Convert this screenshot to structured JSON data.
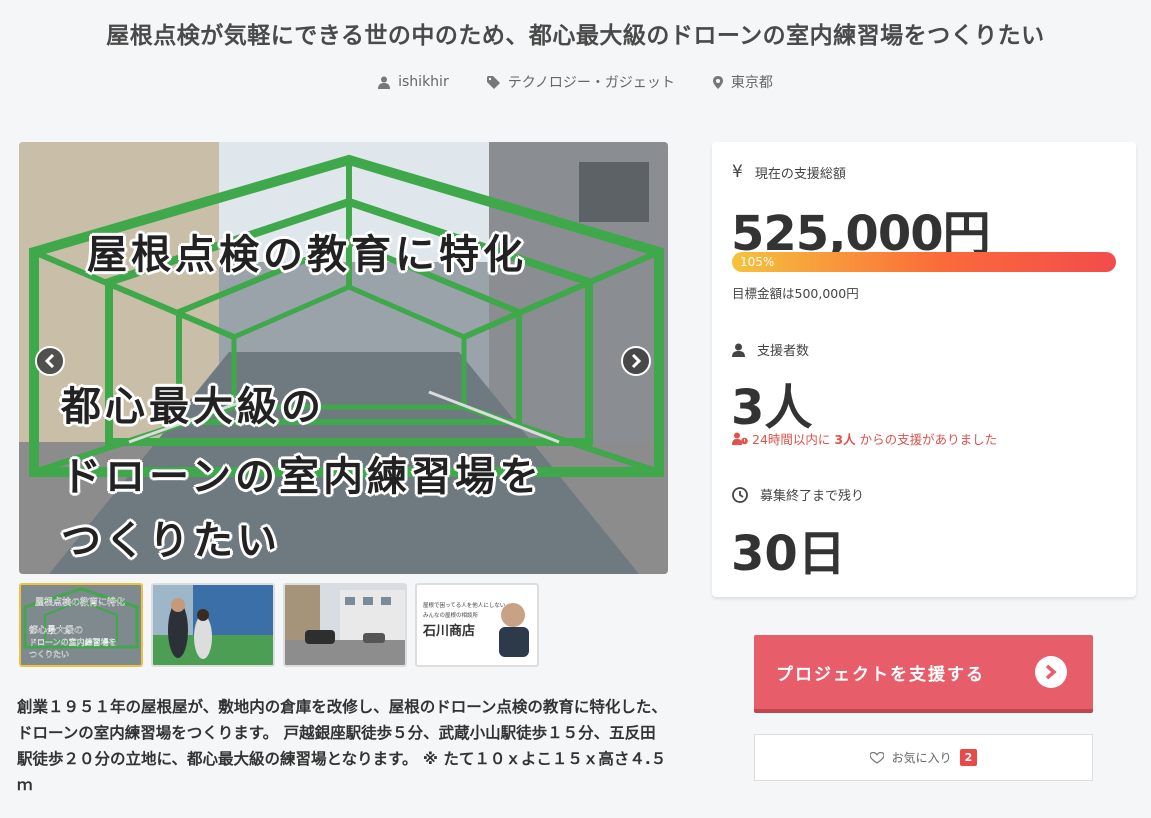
{
  "project": {
    "title": "屋根点検が気軽にできる世の中のため、都心最大級のドローンの室内練習場をつくりたい",
    "owner": "ishikhir",
    "category": "テクノロジー・ガジェット",
    "location": "東京都"
  },
  "hero": {
    "line1": "屋根点検の教育に特化",
    "line2": "都心最大級の",
    "line3": "ドローンの室内練習場を",
    "line4": "つくりたい"
  },
  "thumbnails": {
    "t1": [
      "屋根点検の教育に特化",
      "都心最大級の",
      "ドローンの室内練習場を",
      "つくりたい"
    ],
    "t4": [
      "屋根で困ってる人を他人にしない",
      "みんなの屋根の相談所",
      "石川商店"
    ]
  },
  "description": "創業１９５１年の屋根屋が、敷地内の倉庫を改修し、屋根のドローン点検の教育に特化した、ドローンの室内練習場をつくります。 戸越銀座駅徒歩５分、武蔵小山駅徒歩１５分、五反田駅徒歩２０分の立地に、都心最大級の練習場となります。 ※ たて１０ｘよこ１５ｘ高さ４.５ｍ",
  "stats": {
    "total_label": "現在の支援総額",
    "total_value": "525,000円",
    "progress_text": "105%",
    "progress_percent": 105,
    "goal_text": "目標金額は500,000円",
    "backers_label": "支援者数",
    "backers_value": "3人",
    "recent_prefix": "24時間以内に",
    "recent_count": "3人",
    "recent_suffix": "からの支援がありました",
    "remaining_label": "募集終了まで残り",
    "remaining_value": "30日"
  },
  "actions": {
    "support_label": "プロジェクトを支援する",
    "favorite_label": "お気に入り",
    "favorite_count": "2"
  },
  "colors": {
    "accent": "#e85d6a",
    "alert": "#e2524b",
    "highlight": "#f0c040"
  }
}
